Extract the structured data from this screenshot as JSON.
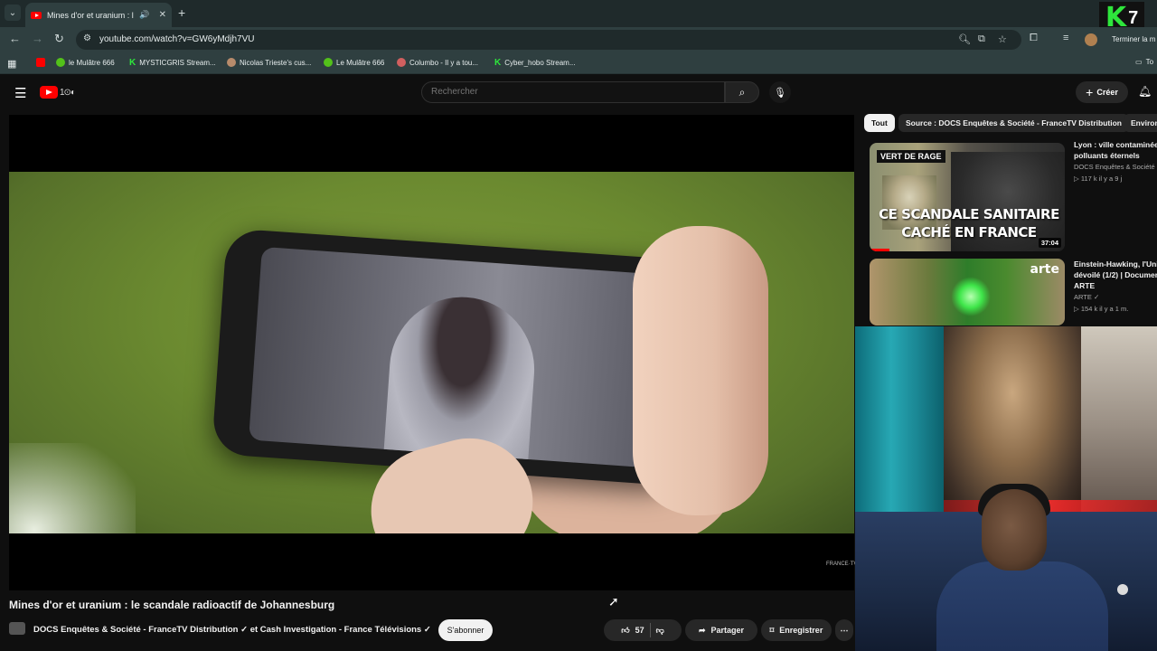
{
  "browser": {
    "tab": {
      "title": "Mines d'or et uranium : le s",
      "audio_icon": "speaker-icon"
    },
    "url": "youtube.com/watch?v=GW6yMdjh7VU",
    "profile_action": "Terminer la m",
    "overlay_logo": {
      "letter": "K",
      "number": "7"
    },
    "bookmarks": [
      {
        "label": "le Mulâtre 666",
        "icon": "play-icon"
      },
      {
        "label": "MYSTICGRIS Stream...",
        "icon": "kick-icon"
      },
      {
        "label": "Nicolas Trieste's cus...",
        "icon": "rabbit-icon"
      },
      {
        "label": "Le Mulâtre 666",
        "icon": "play-icon"
      },
      {
        "label": "Columbo - Il y a tou...",
        "icon": "colombo-icon"
      },
      {
        "label": "Cyber_hobo Stream...",
        "icon": "kick-icon"
      }
    ],
    "bookmarks_folder": "To"
  },
  "youtube": {
    "search_placeholder": "Rechercher",
    "create_label": "Créer",
    "video": {
      "title": "Mines d'or et uranium : le scandale radioactif de Johannesburg",
      "channel": "DOCS Enquêtes & Société - FranceTV Distribution ✓ et Cash Investigation - France Télévisions ✓",
      "subscribe_label": "S'abonner",
      "likes": "57",
      "share_label": "Partager",
      "save_label": "Enregistrer",
      "watermark": "FRANCE·TV"
    },
    "chips": [
      "Tout",
      "Source : DOCS Enquêtes & Société - FranceTV Distribution",
      "Environ"
    ],
    "recommendations": [
      {
        "title": "Lyon : ville contaminée\npolluants éternels",
        "channel": "DOCS Enquêtes & Société -",
        "meta": "▷ 117 k  il y a 9 j",
        "badge": "VERT DE RAGE",
        "overlay_line1": "CE SCANDALE SANITAIRE",
        "overlay_line2": "CACHÉ EN FRANCE",
        "duration": "37:04",
        "progress_fraction": 0.1
      },
      {
        "title": "Einstein-Hawking, l'Univ\ndévoilé (1/2) | Documen\nARTE",
        "channel": "ARTE ✓",
        "meta": "▷ 154 k  il y a 1 m.",
        "brand": "arte"
      }
    ]
  }
}
